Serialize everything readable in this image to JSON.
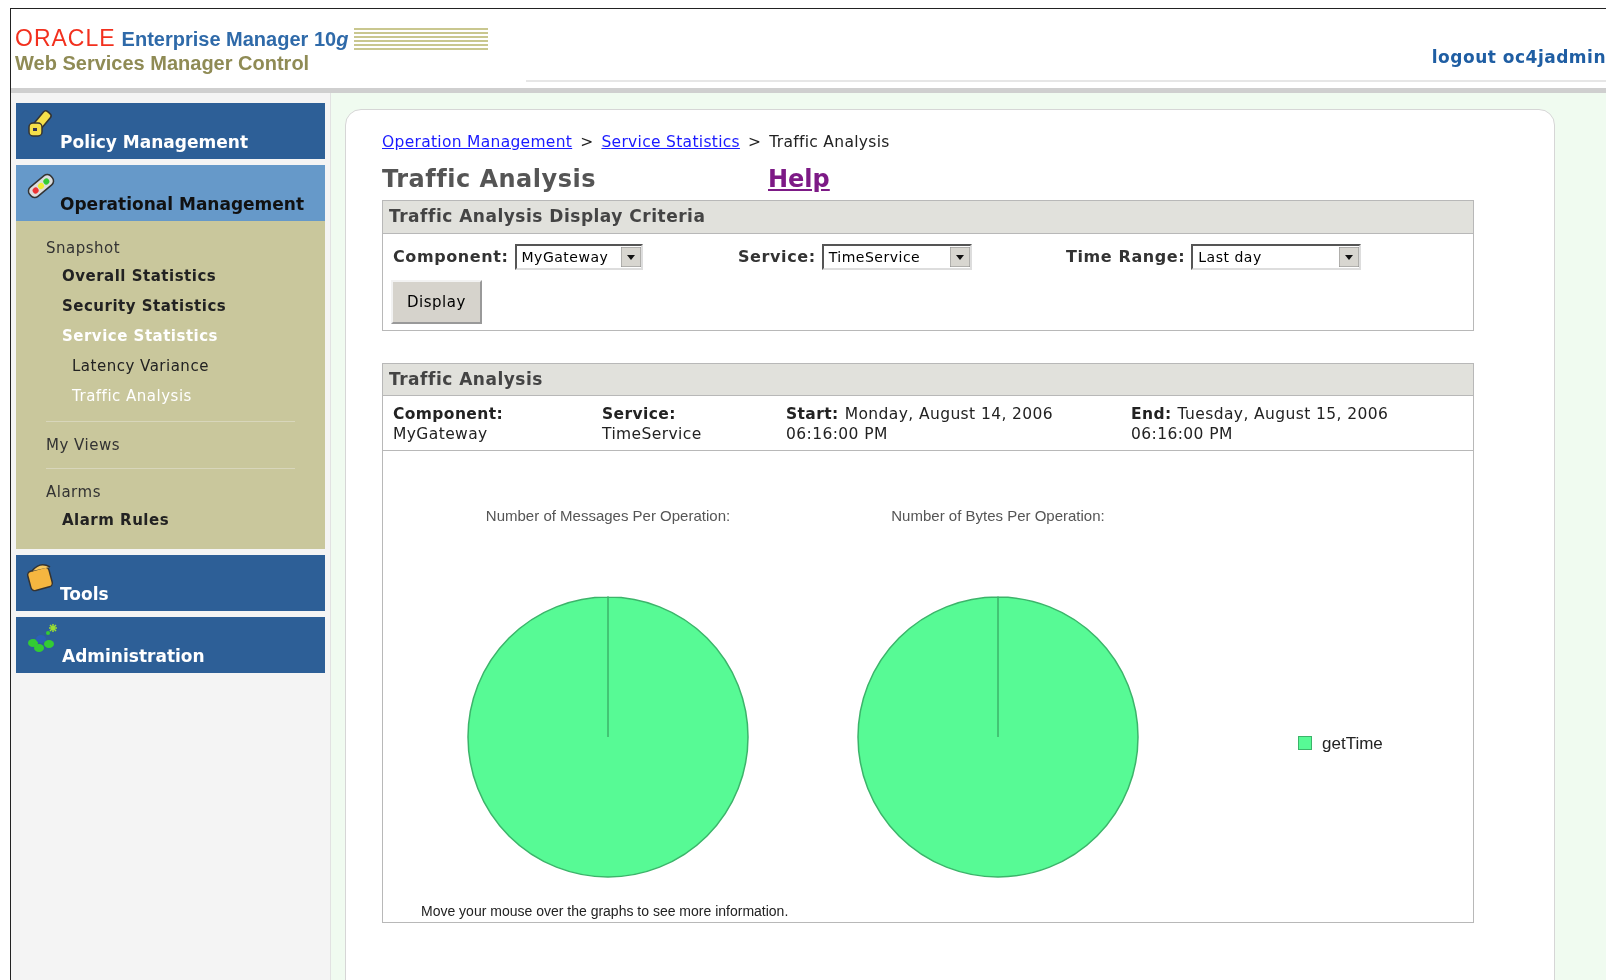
{
  "header": {
    "brand": "ORACLE",
    "product": "Enterprise Manager 10",
    "product_suffix": "g",
    "subtitle": "Web Services Manager Control",
    "logout": "logout oc4jadmin"
  },
  "sidebar": {
    "sections": [
      {
        "label": "Policy Management",
        "selected": false
      },
      {
        "label": "Operational Management",
        "selected": true,
        "groups": [
          {
            "label": "Snapshot",
            "children": [
              {
                "label": "Overall Statistics",
                "selected": false
              },
              {
                "label": "Security Statistics",
                "selected": false
              },
              {
                "label": "Service Statistics",
                "selected": true,
                "children": [
                  {
                    "label": "Latency Variance",
                    "selected": false
                  },
                  {
                    "label": "Traffic Analysis",
                    "selected": true
                  }
                ]
              }
            ]
          },
          {
            "label": "My Views"
          },
          {
            "label": "Alarms",
            "children": [
              {
                "label": "Alarm Rules",
                "selected": false
              }
            ]
          }
        ]
      },
      {
        "label": "Tools",
        "selected": false
      },
      {
        "label": "Administration",
        "selected": false
      }
    ]
  },
  "breadcrumb": [
    {
      "label": "Operation Management",
      "link": true
    },
    {
      "label": ">",
      "link": false
    },
    {
      "label": "Service Statistics",
      "link": true
    },
    {
      "label": ">",
      "link": false
    },
    {
      "label": "Traffic Analysis",
      "link": false
    }
  ],
  "page_title": "Traffic Analysis",
  "help_link": "Help",
  "criteria": {
    "title": "Traffic Analysis Display Criteria",
    "fields": [
      {
        "label": "Component:",
        "value": "MyGateway"
      },
      {
        "label": "Service:",
        "value": "TimeService"
      },
      {
        "label": "Time Range:",
        "value": "Last day"
      }
    ],
    "button": "Display"
  },
  "analysis": {
    "title": "Traffic Analysis",
    "info": [
      {
        "label": "Component:",
        "value": "MyGateway",
        "inline": false
      },
      {
        "label": "Service:",
        "value": "TimeService",
        "inline": false
      },
      {
        "label": "Start:",
        "value": "Monday, August 14, 2006",
        "value2": "06:16:00 PM",
        "inline": true
      },
      {
        "label": "End:",
        "value": "Tuesday, August 15, 2006",
        "value2": "06:16:00 PM",
        "inline": true
      }
    ],
    "charts": [
      {
        "title": "Number of Messages Per Operation:"
      },
      {
        "title": "Number of Bytes Per Operation:"
      }
    ],
    "legend": [
      {
        "label": "getTime",
        "color": "#57fa95"
      }
    ],
    "note": "Move your mouse over the graphs to see more information."
  }
}
